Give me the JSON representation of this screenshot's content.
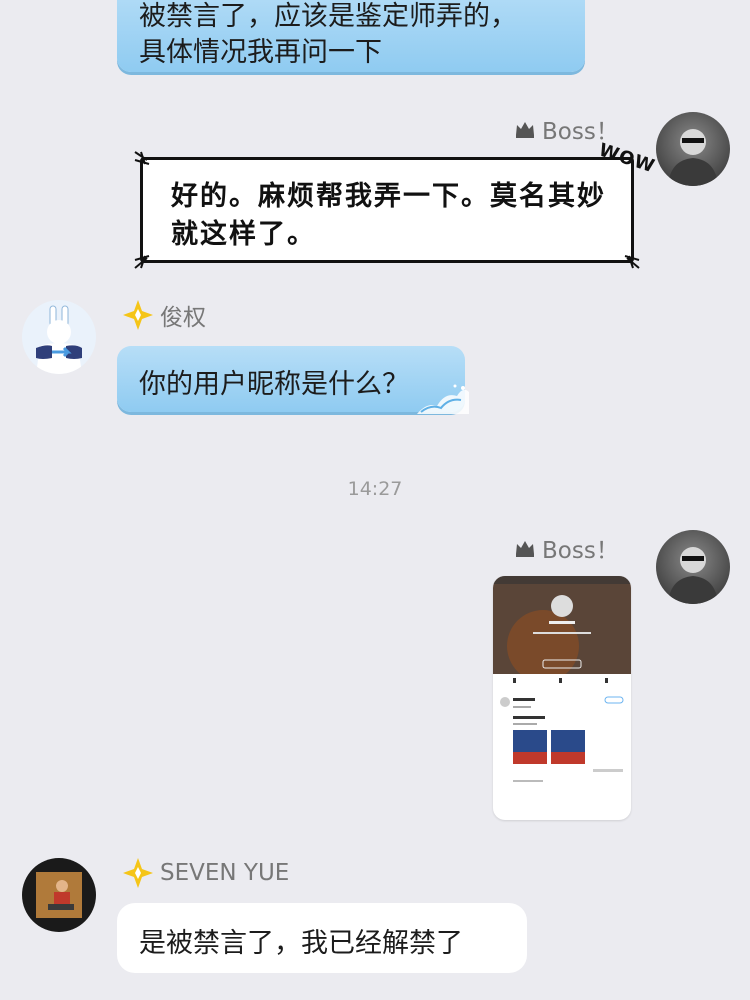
{
  "messages": {
    "top_partial": {
      "line1": "被禁言了，应该是鉴定师弄的，",
      "line2": "具体情况我再问一下"
    },
    "boss_1": {
      "sender": "Boss！",
      "text_line1": "好的。麻烦帮我弄一下。莫名其妙",
      "text_line2": "就这样了。",
      "sticker_word": "WOW"
    },
    "junquan": {
      "sender": "俊权",
      "text": "你的用户昵称是什么？"
    },
    "time_divider": "14:27",
    "boss_2": {
      "sender": "Boss！",
      "image_alt": "profile screenshot"
    },
    "seven_yue": {
      "sender": "SEVEN YUE",
      "text": "是被禁言了，我已经解禁了"
    }
  },
  "colors": {
    "background": "#ebebf0",
    "blue_bubble": "#a9d7f5",
    "diamond": "#f5c518"
  },
  "icons": {
    "crown": "crown-icon",
    "diamond": "diamond-badge-icon"
  }
}
